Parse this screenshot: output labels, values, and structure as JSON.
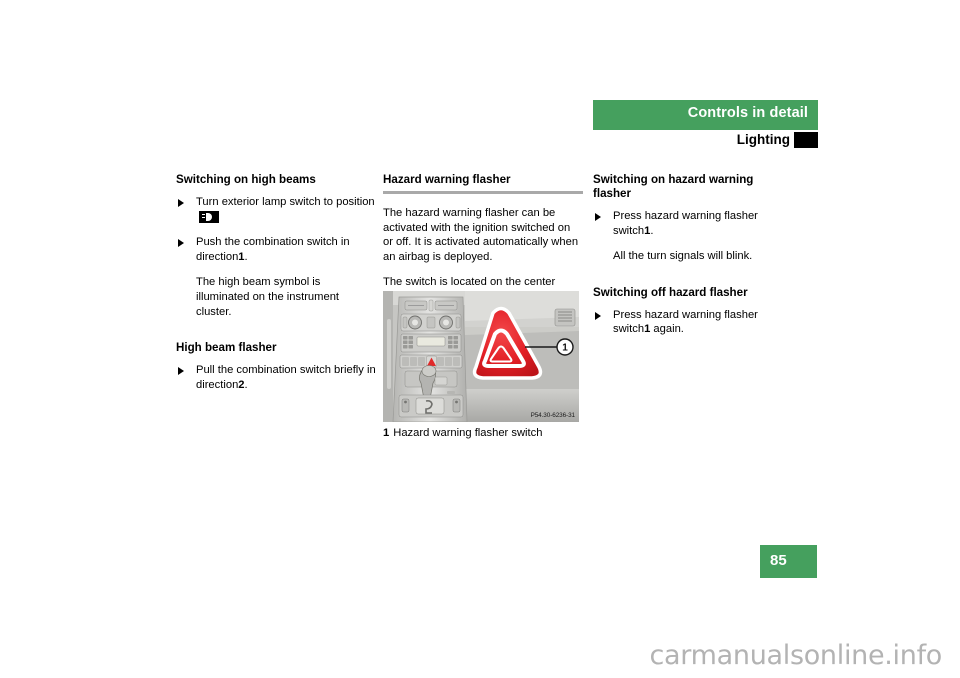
{
  "header": {
    "chapter_title": "Controls in detail",
    "section_title": "Lighting",
    "band_color": "#45a05e",
    "marker_color": "#000000"
  },
  "columns": {
    "left": {
      "sections": [
        {
          "heading": "Switching on high beams",
          "blocks": [
            {
              "type": "bullet",
              "text_before": "Turn exterior lamp switch to position",
              "icon": "high-beam-icon"
            },
            {
              "type": "bullet",
              "text_before": "Push the combination switch in direction",
              "emphasis": "1",
              "text_after": "."
            },
            {
              "type": "note",
              "text": "The high beam symbol is illuminated on the instrument cluster."
            }
          ]
        },
        {
          "heading": "High beam flasher",
          "blocks": [
            {
              "type": "bullet",
              "text_before": "Pull the combination switch briefly in direction",
              "emphasis": "2",
              "text_after": "."
            }
          ]
        }
      ]
    },
    "middle": {
      "heading": "Hazard warning flasher",
      "has_rule": true,
      "paragraphs": [
        "The hazard warning flasher can be activated with the ignition switched on or off. It is activated automatically when an airbag is deployed.",
        "The switch is located on the center console."
      ],
      "figure": {
        "alt": "Center console with hazard warning flasher switch",
        "callout_number": "1",
        "reference_code": "P54.30-6236-31",
        "caption_number": "1",
        "caption_text": "Hazard warning flasher switch"
      }
    },
    "right": {
      "sections": [
        {
          "heading": "Switching on hazard warning flasher",
          "blocks": [
            {
              "type": "bullet",
              "text_before": "Press hazard warning flasher switch",
              "emphasis": "1",
              "text_after": "."
            },
            {
              "type": "note",
              "text": "All the turn signals will blink."
            }
          ]
        },
        {
          "heading": "Switching off hazard flasher",
          "blocks": [
            {
              "type": "bullet",
              "text_before": "Press hazard warning flasher switch",
              "emphasis": "1",
              "text_after": " again."
            }
          ]
        }
      ]
    }
  },
  "footer": {
    "page_number": "85",
    "watermark": "carmanualsonline.info"
  }
}
